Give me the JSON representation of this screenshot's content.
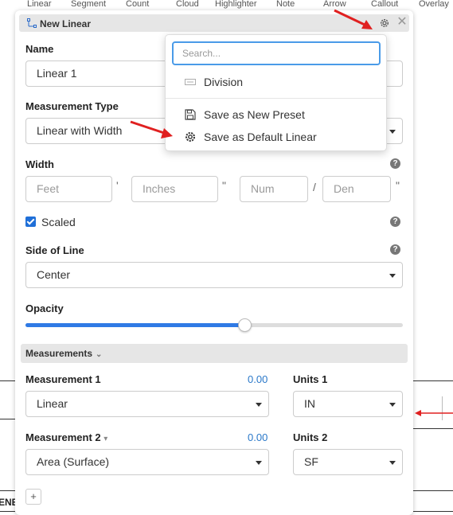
{
  "toolbar": {
    "items": [
      "Linear",
      "Segment",
      "Count",
      "Cloud",
      "Highlighter",
      "Note",
      "Arrow",
      "Callout",
      "Overlay"
    ]
  },
  "background": {
    "partial_text": "ENE"
  },
  "panel": {
    "title": "New Linear",
    "close_glyph": "✕",
    "name": {
      "label": "Name",
      "value": "Linear 1"
    },
    "measurement_type": {
      "label": "Measurement Type",
      "value": "Linear with Width"
    },
    "width": {
      "label": "Width",
      "help": "?",
      "feet_placeholder": "Feet",
      "feet_mark": "'",
      "inches_placeholder": "Inches",
      "inches_mark": "\"",
      "num_placeholder": "Num",
      "fraction_mark": "/",
      "den_placeholder": "Den",
      "den_mark": "\""
    },
    "scaled": {
      "label": "Scaled",
      "checked": true,
      "help": "?"
    },
    "side_of_line": {
      "label": "Side of Line",
      "value": "Center",
      "help": "?"
    },
    "opacity": {
      "label": "Opacity",
      "value_fraction": 0.58
    },
    "measurements": {
      "section_label": "Measurements",
      "chevron": "⌄",
      "m1": {
        "label": "Measurement 1",
        "value": "0.00",
        "type": "Linear"
      },
      "units1": {
        "label": "Units 1",
        "value": "IN"
      },
      "m2": {
        "label": "Measurement 2",
        "chevron": "▾",
        "value": "0.00",
        "type": "Area (Surface)"
      },
      "units2": {
        "label": "Units 2",
        "value": "SF"
      },
      "add_label": "+"
    }
  },
  "popup": {
    "search_placeholder": "Search...",
    "items": [
      {
        "label": "Division",
        "icon": "division-icon"
      },
      {
        "label": "Save as New Preset",
        "icon": "save-icon"
      },
      {
        "label": "Save as Default Linear",
        "icon": "gear-icon"
      }
    ]
  },
  "colors": {
    "accent": "#2f7ae5",
    "annotation_arrow": "#e02020",
    "link_value": "#2a78c9"
  }
}
